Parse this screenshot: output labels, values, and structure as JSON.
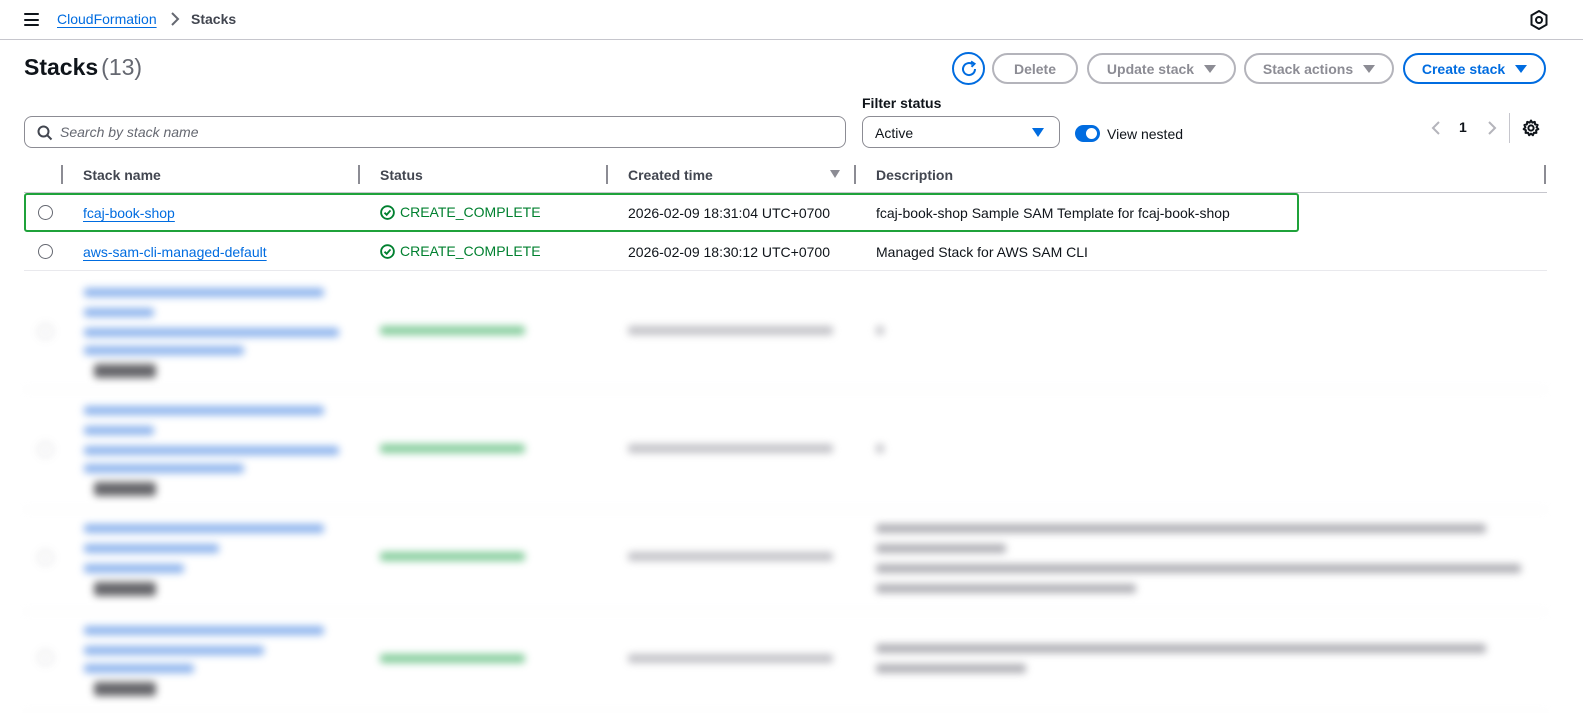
{
  "breadcrumb": {
    "parent": "CloudFormation",
    "current": "Stacks"
  },
  "header": {
    "title": "Stacks",
    "count": "(13)",
    "buttons": {
      "delete": "Delete",
      "update": "Update stack",
      "actions": "Stack actions",
      "create": "Create stack"
    }
  },
  "filters": {
    "search_placeholder": "Search by stack name",
    "status_label": "Filter status",
    "status_value": "Active",
    "view_nested_label": "View nested",
    "view_nested_on": true
  },
  "pagination": {
    "current_page": "1"
  },
  "table": {
    "columns": [
      "Stack name",
      "Status",
      "Created time",
      "Description"
    ],
    "rows": [
      {
        "name": "fcaj-book-shop",
        "status": "CREATE_COMPLETE",
        "created": "2026-02-09 18:31:04 UTC+0700",
        "description": "fcaj-book-shop Sample SAM Template for fcaj-book-shop",
        "highlighted": true
      },
      {
        "name": "aws-sam-cli-managed-default",
        "status": "CREATE_COMPLETE",
        "created": "2026-02-09 18:30:12 UTC+0700",
        "description": "Managed Stack for AWS SAM CLI",
        "highlighted": false
      }
    ]
  },
  "colors": {
    "link": "#006ce0",
    "success": "#00802f",
    "highlight_outline": "#1fa23a"
  }
}
